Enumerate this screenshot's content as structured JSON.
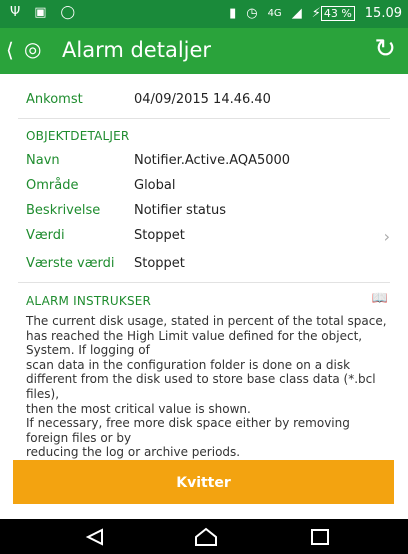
{
  "status_bar": {
    "left_icons": [
      "usb-icon",
      "image-icon",
      "android-debug-icon"
    ],
    "network": "4G",
    "battery": "43 %",
    "time": "15.09"
  },
  "app_bar": {
    "title": "Alarm detaljer",
    "color": "#2aa33b"
  },
  "details": {
    "arrival_label": "Ankomst",
    "arrival_value": "04/09/2015 14.46.40"
  },
  "object_details": {
    "section_title": "OBJEKTDETALJER",
    "rows": [
      {
        "label": "Navn",
        "value": "Notifier.Active.AQA5000"
      },
      {
        "label": "Område",
        "value": "Global"
      },
      {
        "label": "Beskrivelse",
        "value": "Notifier status"
      },
      {
        "label": "Værdi",
        "value": "Stoppet"
      },
      {
        "label": "Værste værdi",
        "value": "Stoppet"
      }
    ]
  },
  "alarm_instructions": {
    "section_title": "ALARM INSTRUKSER",
    "text": "The current disk usage, stated in percent of the total space, has reached the High Limit value defined for the object, System. If logging of\nscan data in the configuration folder is done on a disk different from the disk used to store base class data (*.bcl files),\nthen the most critical value is shown.\nIf necessary, free more disk space either by removing foreign files or by\nreducing the log or archive periods."
  },
  "action": {
    "button_label": "Kvitter",
    "color": "#f3a310"
  }
}
